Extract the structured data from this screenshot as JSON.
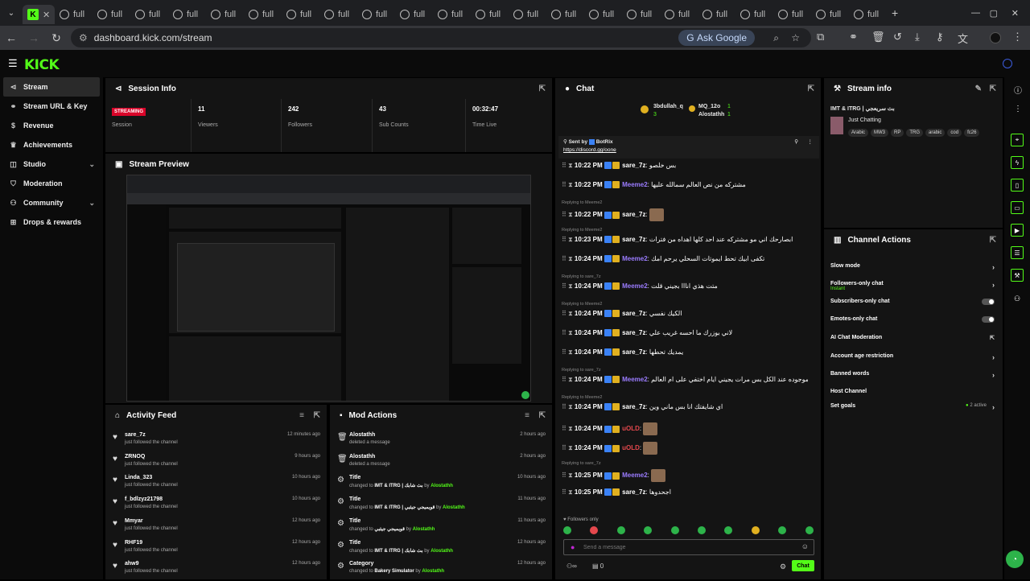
{
  "browser": {
    "tabs": [
      "full",
      "full",
      "full",
      "full",
      "full",
      "full",
      "full",
      "full",
      "full",
      "full",
      "full",
      "full",
      "full",
      "full",
      "full",
      "full",
      "full",
      "full",
      "full",
      "full",
      "full",
      "full"
    ],
    "url": "dashboard.kick.com/stream",
    "ask_google": "Ask Google"
  },
  "brand": {
    "logo": "KICK",
    "accent": "#53fc18"
  },
  "sidebar": {
    "items": [
      {
        "label": "Stream",
        "icon": "stream-icon"
      },
      {
        "label": "Stream URL & Key",
        "icon": "link-icon"
      },
      {
        "label": "Revenue",
        "icon": "revenue-icon"
      },
      {
        "label": "Achievements",
        "icon": "trophy-icon"
      },
      {
        "label": "Studio",
        "icon": "studio-icon"
      },
      {
        "label": "Moderation",
        "icon": "shield-icon"
      },
      {
        "label": "Community",
        "icon": "community-icon"
      },
      {
        "label": "Drops & rewards",
        "icon": "gift-icon"
      }
    ]
  },
  "session": {
    "title": "Session Info",
    "status": "STREAMING",
    "status_label": "Session",
    "stats": [
      {
        "value": "11",
        "label": "Viewers"
      },
      {
        "value": "242",
        "label": "Followers"
      },
      {
        "value": "43",
        "label": "Sub Counts"
      },
      {
        "value": "00:32:47",
        "label": "Time Live"
      }
    ]
  },
  "preview": {
    "title": "Stream Preview"
  },
  "activity": {
    "title": "Activity Feed",
    "items": [
      {
        "name": "sare_7z",
        "action": "just followed the channel",
        "time": "12 minutes ago"
      },
      {
        "name": "ZRNOQ",
        "action": "just followed the channel",
        "time": "9 hours ago"
      },
      {
        "name": "Linda_323",
        "action": "just followed the channel",
        "time": "10 hours ago"
      },
      {
        "name": "f_bdlzyz21798",
        "action": "just followed the channel",
        "time": "10 hours ago"
      },
      {
        "name": "Mmyar",
        "action": "just followed the channel",
        "time": "12 hours ago"
      },
      {
        "name": "RHF19",
        "action": "just followed the channel",
        "time": "12 hours ago"
      },
      {
        "name": "ahw9",
        "action": "just followed the channel",
        "time": "12 hours ago"
      }
    ]
  },
  "mod": {
    "title": "Mod Actions",
    "items": [
      {
        "name": "Alostathh",
        "pre": "deleted a message",
        "val": "",
        "by": "",
        "time": "2 hours ago"
      },
      {
        "name": "Alostathh",
        "pre": "deleted a message",
        "val": "",
        "by": "",
        "time": "2 hours ago"
      },
      {
        "name": "Title",
        "pre": "changed to",
        "val": "IMT & ITRG | بث شابك",
        "by": "Alostathh",
        "time": "10 hours ago"
      },
      {
        "name": "Title",
        "pre": "changed to",
        "val": "IMT & ITRG | قويميجي جيثبي",
        "by": "Alostathh",
        "time": "11 hours ago"
      },
      {
        "name": "Title",
        "pre": "changed to",
        "val": "قويميجي جيثبي",
        "by": "Alostathh",
        "time": "11 hours ago"
      },
      {
        "name": "Title",
        "pre": "changed to",
        "val": "IMT & ITRG | بث شابك",
        "by": "Alostathh",
        "time": "12 hours ago"
      },
      {
        "name": "Category",
        "pre": "changed to",
        "val": "Bakery Simulator",
        "by": "Alostathh",
        "time": "12 hours ago"
      }
    ],
    "by_word": "by"
  },
  "chat": {
    "title": "Chat",
    "top_users": [
      {
        "name": "3bdullah_q",
        "count": "3"
      },
      {
        "name": "MQ_12o",
        "count": "1"
      },
      {
        "name": "Alostathh",
        "count": "1"
      }
    ],
    "pinned_label": "Sent by",
    "pinned_by": "BotRix",
    "pinned_link": "https://discord.gg/oone",
    "messages": [
      {
        "time": "10:22 PM",
        "user": "sare_7z",
        "text": "بس خلصو",
        "reply": ""
      },
      {
        "time": "10:22 PM",
        "user": "Meeme2",
        "text": "مشتركه من نص العالم سمالله عليها",
        "reply": ""
      },
      {
        "time": "10:22 PM",
        "user": "sare_7z",
        "text": "",
        "reply": "Replying to Meeme2"
      },
      {
        "time": "10:23 PM",
        "user": "sare_7z",
        "text": "ابصارحك اني مو مشتركه عند احد كلها اهداه من فترات",
        "reply": "Replying to Meeme2"
      },
      {
        "time": "10:24 PM",
        "user": "Meeme2",
        "text": "تكفى ابيك تحط ايموتات السحلي يرحم امك",
        "reply": ""
      },
      {
        "time": "10:24 PM",
        "user": "Meeme2",
        "text": "متت هذي انااا بجيني قلت",
        "reply": "Replying to sare_7z"
      },
      {
        "time": "10:24 PM",
        "user": "sare_7z",
        "text": "الكيك نفسي",
        "reply": "Replying to Meeme2"
      },
      {
        "time": "10:24 PM",
        "user": "sare_7z",
        "text": "لاني بوزرك ما احسه غريب علي",
        "reply": ""
      },
      {
        "time": "10:24 PM",
        "user": "sare_7z",
        "text": "يمديك تحطها",
        "reply": ""
      },
      {
        "time": "10:24 PM",
        "user": "Meeme2",
        "text": "موجوده عند الكل بس مرات يجيني ايام اختفي على ام العالم",
        "reply": "Replying to sare_7z"
      },
      {
        "time": "10:24 PM",
        "user": "sare_7z",
        "text": "اي شايفتك انا بس ماني وين",
        "reply": "Replying to Meeme2"
      },
      {
        "time": "10:24 PM",
        "user": "uOLD",
        "text": "",
        "reply": ""
      },
      {
        "time": "10:24 PM",
        "user": "uOLD",
        "text": "",
        "reply": ""
      },
      {
        "time": "10:25 PM",
        "user": "Meeme2",
        "text": "",
        "reply": "Replying to sare_7z"
      },
      {
        "time": "10:25 PM",
        "user": "sare_7z",
        "text": "اجحدوها",
        "reply": ""
      }
    ],
    "followers_only": "Followers only",
    "placeholder": "Send a message",
    "count": "0",
    "send_label": "Chat"
  },
  "stream_info": {
    "title": "Stream info",
    "stream_title": "IMT & ITRG | بث سريعجي",
    "category": "Just Chatting",
    "tags": [
      "Arabic",
      "MW3",
      "RP",
      "TRG",
      "arabic",
      "cod",
      "fc26"
    ]
  },
  "channel_actions": {
    "title": "Channel Actions",
    "items": [
      {
        "label": "Slow mode",
        "kind": "arrow",
        "sub": ""
      },
      {
        "label": "Followers-only chat",
        "kind": "arrow",
        "sub": "Instant"
      },
      {
        "label": "Subscribers-only chat",
        "kind": "toggle",
        "sub": ""
      },
      {
        "label": "Emotes-only chat",
        "kind": "toggle",
        "sub": ""
      },
      {
        "label": "AI Chat Moderation",
        "kind": "external",
        "sub": ""
      },
      {
        "label": "Account age restriction",
        "kind": "arrow",
        "sub": ""
      },
      {
        "label": "Banned words",
        "kind": "arrow",
        "sub": ""
      },
      {
        "label": "Host Channel",
        "kind": "none",
        "sub": ""
      },
      {
        "label": "Set goals",
        "kind": "arrow",
        "sub": "2 active"
      }
    ]
  }
}
